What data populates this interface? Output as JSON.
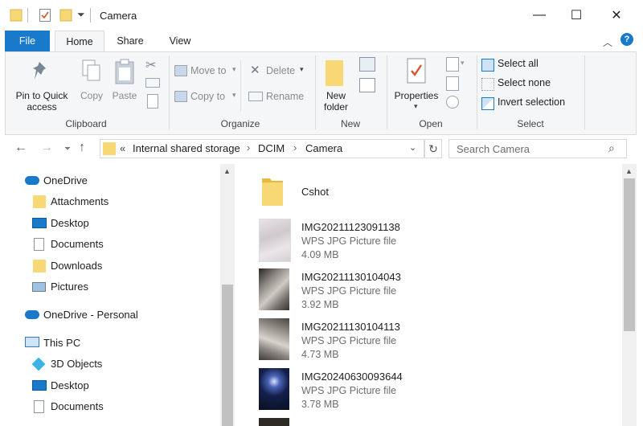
{
  "window": {
    "title": "Camera",
    "minimize_glyph": "—",
    "maximize_glyph": "☐",
    "close_glyph": "✕"
  },
  "tabs": [
    {
      "label": "File"
    },
    {
      "label": "Home"
    },
    {
      "label": "Share"
    },
    {
      "label": "View"
    }
  ],
  "ribbon": {
    "clipboard": {
      "group_label": "Clipboard",
      "pin_label_1": "Pin to Quick",
      "pin_label_2": "access",
      "copy_label": "Copy",
      "paste_label": "Paste"
    },
    "organize": {
      "group_label": "Organize",
      "move_to": "Move to",
      "copy_to": "Copy to",
      "delete": "Delete",
      "rename": "Rename"
    },
    "new": {
      "group_label": "New",
      "new_folder_1": "New",
      "new_folder_2": "folder"
    },
    "open": {
      "group_label": "Open",
      "properties": "Properties"
    },
    "select": {
      "group_label": "Select",
      "select_all": "Select all",
      "select_none": "Select none",
      "invert_selection": "Invert selection"
    }
  },
  "address": {
    "overflow": "«",
    "crumbs": [
      "Internal shared storage",
      "DCIM",
      "Camera"
    ],
    "separator": "›"
  },
  "search": {
    "placeholder": "Search Camera"
  },
  "nav": {
    "items": [
      {
        "label": "OneDrive",
        "icon": "cloud-icon"
      },
      {
        "label": "Attachments",
        "icon": "folder-icon"
      },
      {
        "label": "Desktop",
        "icon": "desktop-icon"
      },
      {
        "label": "Documents",
        "icon": "document-icon"
      },
      {
        "label": "Downloads",
        "icon": "folder-icon"
      },
      {
        "label": "Pictures",
        "icon": "pictures-icon"
      },
      {
        "label": "OneDrive - Personal",
        "icon": "cloud-icon"
      },
      {
        "label": "This PC",
        "icon": "computer-icon"
      },
      {
        "label": "3D Objects",
        "icon": "cube-icon"
      },
      {
        "label": "Desktop",
        "icon": "desktop-icon"
      },
      {
        "label": "Documents",
        "icon": "document-icon"
      }
    ]
  },
  "files": [
    {
      "name": "Cshot",
      "type": "folder"
    },
    {
      "name": "IMG20211123091138",
      "kind": "WPS JPG Picture file",
      "size": "4.09 MB"
    },
    {
      "name": "IMG20211130104043",
      "kind": "WPS JPG Picture file",
      "size": "3.92 MB"
    },
    {
      "name": "IMG20211130104113",
      "kind": "WPS JPG Picture file",
      "size": "4.73 MB"
    },
    {
      "name": "IMG20240630093644",
      "kind": "WPS JPG Picture file",
      "size": "3.78 MB"
    }
  ],
  "colors": {
    "accent": "#1979ca",
    "folder": "#f8d775",
    "ribbon_bg": "#f5f6f7"
  }
}
